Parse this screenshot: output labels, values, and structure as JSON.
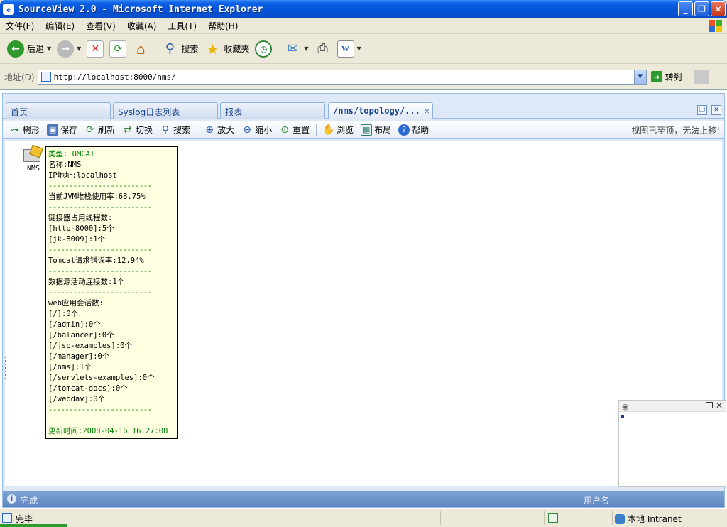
{
  "window": {
    "title": "SourceView 2.0 - Microsoft Internet Explorer"
  },
  "menu": [
    "文件(F)",
    "编辑(E)",
    "查看(V)",
    "收藏(A)",
    "工具(T)",
    "帮助(H)"
  ],
  "toolbar": {
    "back": "后退",
    "search": "搜索",
    "favorites": "收藏夹"
  },
  "address": {
    "label": "地址(D)",
    "url": "http://localhost:8000/nms/",
    "go": "转到"
  },
  "tabs": [
    {
      "label": "首页"
    },
    {
      "label": "Syslog日志列表"
    },
    {
      "label": "报表"
    },
    {
      "label": "/nms/topology/..."
    }
  ],
  "inner_toolbar": {
    "tree": "树形",
    "save": "保存",
    "refresh": "刷新",
    "switch": "切换",
    "search": "搜索",
    "zoom_in": "放大",
    "zoom_out": "缩小",
    "reset": "重置",
    "browse": "浏览",
    "layout": "布局",
    "help": "帮助",
    "message": "视图已至顶，无法上移!"
  },
  "node": {
    "label": "NMS"
  },
  "tooltip": {
    "type": "类型:TOMCAT",
    "name": "名称:NMS",
    "ip": "IP地址:localhost",
    "separator": "-------------------------",
    "jvm": "当前JVM堆栈使用率:68.75%",
    "connector_title": "链接器占用线程数:",
    "connector_1": "[http-8000]:5个",
    "connector_2": "[jk-8009]:1个",
    "error_rate": "Tomcat请求错误率:12.94%",
    "datasource": "数据源活动连接数:1个",
    "sessions_title": "web应用会话数:",
    "sessions": [
      "[/]:0个",
      "[/admin]:0个",
      "[/balancer]:0个",
      "[/jsp-examples]:0个",
      "[/manager]:0个",
      "[/nms]:1个",
      "[/servlets-examples]:0个",
      "[/tomcat-docs]:0个",
      "[/webdav]:0个"
    ],
    "updated": "更新时间:2008-04-16 16:27:08"
  },
  "app_status": {
    "left": "完成",
    "right": "用户名"
  },
  "ie_status": {
    "left": "完毕",
    "zone": "本地 Intranet"
  }
}
